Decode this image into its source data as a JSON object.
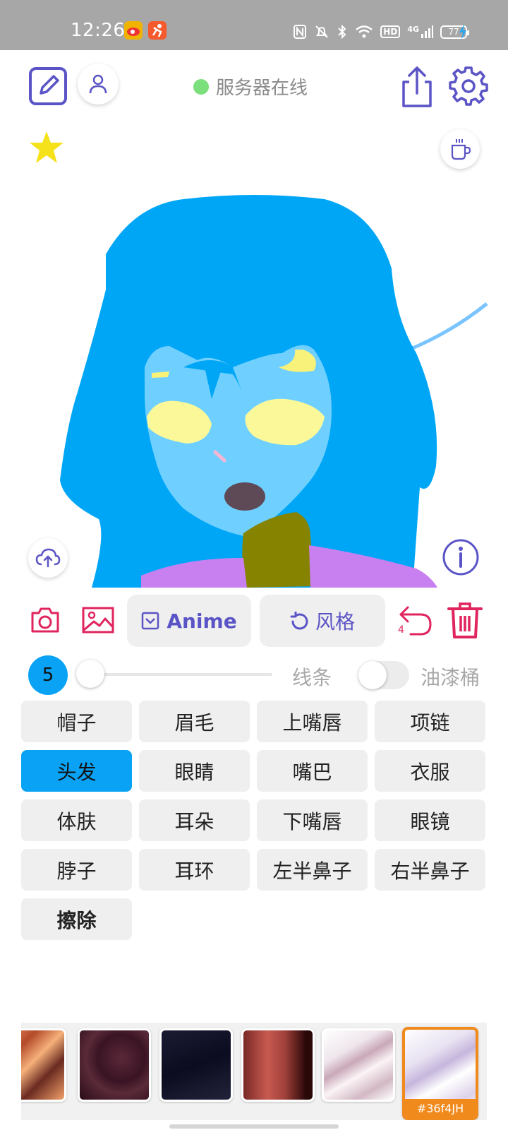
{
  "status_bar": {
    "time": "12:26",
    "network": "4G",
    "hd": "HD",
    "battery": "77"
  },
  "header": {
    "server_status": "服务器在线",
    "server_status_color": "#7be07b"
  },
  "toolbar": {
    "model_label": "Anime",
    "style_label": "风格",
    "undo_count": "4"
  },
  "brush": {
    "size": "5",
    "line_label": "线条",
    "bucket_label": "油漆桶"
  },
  "parts": [
    {
      "label": "帽子"
    },
    {
      "label": "眉毛"
    },
    {
      "label": "上嘴唇"
    },
    {
      "label": "项链"
    },
    {
      "label": "头发",
      "active": true
    },
    {
      "label": "眼睛"
    },
    {
      "label": "嘴巴"
    },
    {
      "label": "衣服"
    },
    {
      "label": "体肤"
    },
    {
      "label": "耳朵"
    },
    {
      "label": "下嘴唇"
    },
    {
      "label": "眼镜"
    },
    {
      "label": "脖子"
    },
    {
      "label": "耳环"
    },
    {
      "label": "左半鼻子"
    },
    {
      "label": "右半鼻子"
    },
    {
      "label": "擦除"
    }
  ],
  "swatches": {
    "selected_tag": "#36f4JH"
  },
  "colors": {
    "accent": "#5b54c6",
    "danger": "#e0245e",
    "active_part": "#0aa2f5"
  }
}
